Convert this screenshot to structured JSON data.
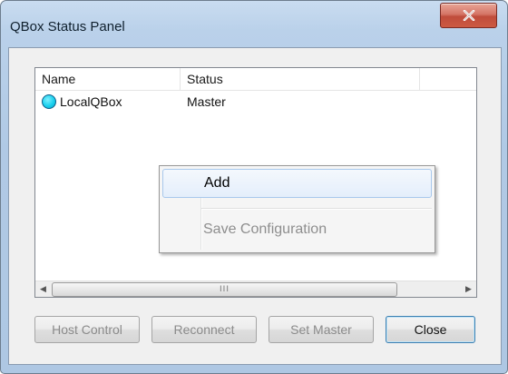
{
  "window": {
    "title": "QBox Status Panel"
  },
  "listview": {
    "columns": [
      {
        "label": "Name"
      },
      {
        "label": "Status"
      },
      {
        "label": ""
      }
    ],
    "rows": [
      {
        "name": "LocalQBox",
        "status": "Master",
        "icon": "status-circle-cyan-icon",
        "icon_color": "#1ad0ee"
      }
    ],
    "hscroll_grip": "III"
  },
  "context_menu": {
    "items": [
      {
        "label": "Add",
        "state": "highlighted"
      },
      {
        "label": "Save Configuration",
        "state": "disabled"
      }
    ]
  },
  "buttons": {
    "host_control": "Host Control",
    "reconnect": "Reconnect",
    "set_master": "Set Master",
    "close": "Close"
  },
  "colors": {
    "titlebar": "#b0c9e5",
    "close_button": "#c04c3b",
    "menu_highlight": "#e4eefb",
    "disabled_text": "#8a8a8a"
  }
}
